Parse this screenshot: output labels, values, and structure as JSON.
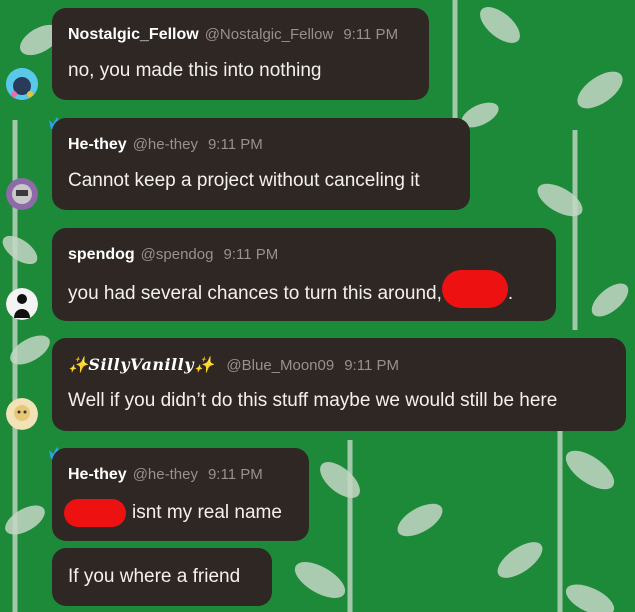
{
  "messages": [
    {
      "username": "Nostalgic_Fellow",
      "handle": "@Nostalgic_Fellow",
      "time": "9:11 PM",
      "text": "no, you made this into nothing"
    },
    {
      "username": "He-they",
      "handle": "@he-they",
      "time": "9:11 PM",
      "text": "Cannot keep a project without canceling it"
    },
    {
      "username": "spendog",
      "handle": "@spendog",
      "time": "9:11 PM",
      "text": "you had several chances to turn this around,",
      "text_after": "."
    },
    {
      "username": "SillyVanilly",
      "sparkle": "✨",
      "handle": "@Blue_Moon09",
      "time": "9:11 PM",
      "text": "Well if you didn’t do this stuff maybe we would still be here"
    },
    {
      "username": "He-they",
      "handle": "@he-they",
      "time": "9:11 PM",
      "text": "isnt my real name"
    },
    {
      "text": "If you where a friend"
    }
  ],
  "colors": {
    "background": "#1f8a3a",
    "bubble": "#2f2724",
    "crown": "#2aa4ee",
    "redaction": "#ee1111"
  },
  "icons": [
    "crown-icon",
    "avatar",
    "sparkle-icon"
  ]
}
